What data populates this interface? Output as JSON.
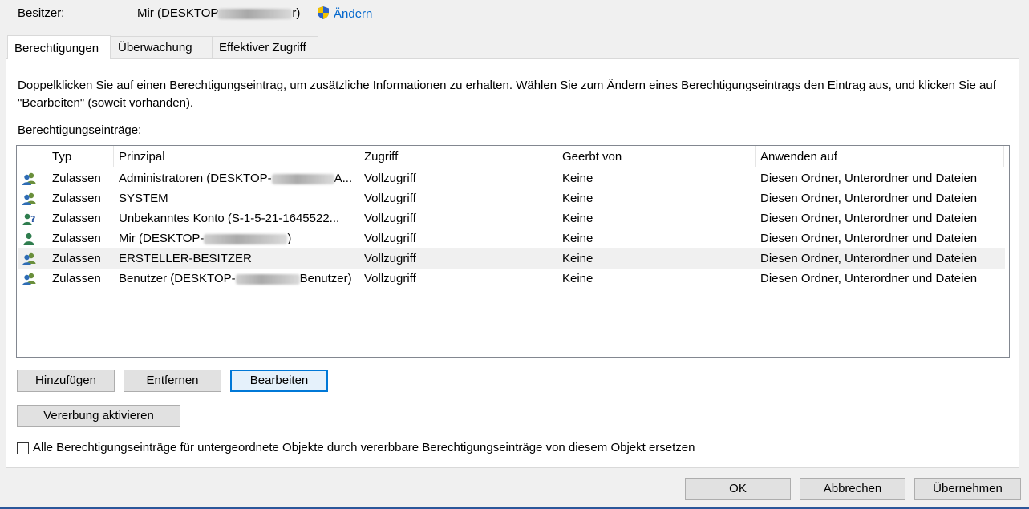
{
  "owner": {
    "label": "Besitzer:",
    "value_prefix": "Mir (DESKTOP",
    "value_suffix": "r)",
    "change_label": "Ändern"
  },
  "tabs": [
    "Berechtigungen",
    "Überwachung",
    "Effektiver Zugriff"
  ],
  "description": "Doppelklicken Sie auf einen Berechtigungseintrag, um zusätzliche Informationen zu erhalten. Wählen Sie zum Ändern eines Berechtigungseintrags den Eintrag aus, und klicken Sie auf \"Bearbeiten\" (soweit vorhanden).",
  "list_label": "Berechtigungseinträge:",
  "columns": [
    "Typ",
    "Prinzipal",
    "Zugriff",
    "Geerbt von",
    "Anwenden auf"
  ],
  "entries": [
    {
      "icon": "users-group-icon",
      "type": "Zulassen",
      "principal_prefix": "Administratoren (DESKTOP-",
      "principal_suffix": "A...",
      "access": "Vollzugriff",
      "inherited": "Keine",
      "applies": "Diesen Ordner, Unterordner und Dateien"
    },
    {
      "icon": "users-group-icon",
      "type": "Zulassen",
      "principal_prefix": "SYSTEM",
      "principal_suffix": "",
      "access": "Vollzugriff",
      "inherited": "Keine",
      "applies": "Diesen Ordner, Unterordner und Dateien"
    },
    {
      "icon": "unknown-user-icon",
      "type": "Zulassen",
      "principal_prefix": "Unbekanntes Konto (S-1-5-21-1645522...",
      "principal_suffix": "",
      "access": "Vollzugriff",
      "inherited": "Keine",
      "applies": "Diesen Ordner, Unterordner und Dateien"
    },
    {
      "icon": "single-user-icon",
      "type": "Zulassen",
      "principal_prefix": "Mir (DESKTOP-",
      "principal_suffix": ")",
      "access": "Vollzugriff",
      "inherited": "Keine",
      "applies": "Diesen Ordner, Unterordner und Dateien"
    },
    {
      "icon": "users-group-icon",
      "type": "Zulassen",
      "principal_prefix": "ERSTELLER-BESITZER",
      "principal_suffix": "",
      "access": "Vollzugriff",
      "inherited": "Keine",
      "applies": "Diesen Ordner, Unterordner und Dateien",
      "selected": true
    },
    {
      "icon": "users-group-icon",
      "type": "Zulassen",
      "principal_prefix": "Benutzer (DESKTOP-",
      "principal_suffix": "Benutzer)",
      "access": "Vollzugriff",
      "inherited": "Keine",
      "applies": "Diesen Ordner, Unterordner und Dateien"
    }
  ],
  "buttons": {
    "add": "Hinzufügen",
    "remove": "Entfernen",
    "edit": "Bearbeiten",
    "enable_inheritance": "Vererbung aktivieren",
    "ok": "OK",
    "cancel": "Abbrechen",
    "apply": "Übernehmen"
  },
  "replace_checkbox_label": "Alle Berechtigungseinträge für untergeordnete Objekte durch vererbbare Berechtigungseinträge von diesem Objekt ersetzen",
  "colors": {
    "link": "#0066cc",
    "focus": "#0078d7",
    "selected_row": "#f0f0f0"
  }
}
